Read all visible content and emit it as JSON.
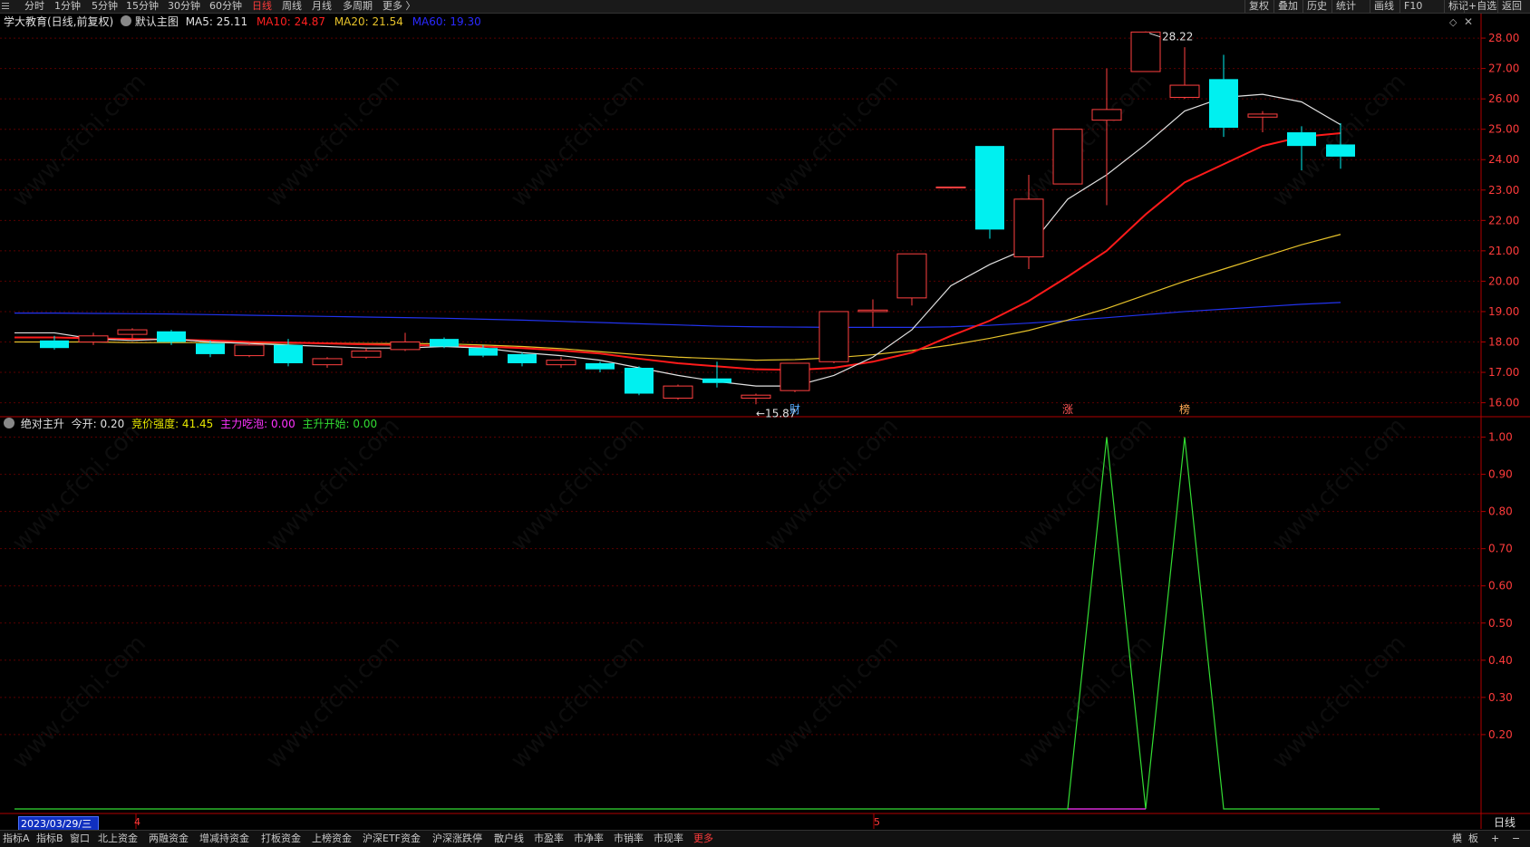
{
  "topbar": {
    "menu_icon": "hamburger-icon",
    "periods": [
      "分时",
      "1分钟",
      "5分钟",
      "15分钟",
      "30分钟",
      "60分钟",
      "日线",
      "周线",
      "月线",
      "多周期",
      "更多 〉"
    ],
    "active_period": "日线",
    "right_buttons": [
      "复权",
      "叠加",
      "历史",
      "统计",
      "画线",
      "F10",
      "+自选",
      "返回"
    ],
    "right_extras": [
      "标记"
    ]
  },
  "main_legend": {
    "title": "学大教育(日线,前复权)",
    "preset": "默认主图",
    "ma5_label": "MA5: 25.11",
    "ma10_label": "MA10: 24.87",
    "ma20_label": "MA20: 21.54",
    "ma60_label": "MA60: 19.30",
    "colors": {
      "ma5": "#e0e0e0",
      "ma10": "#ff2020",
      "ma20": "#e6c22a",
      "ma60": "#2a2aff"
    },
    "corner_icons": [
      "diamond-icon",
      "close-icon"
    ]
  },
  "price_axis": {
    "ticks": [
      "28.00",
      "27.00",
      "26.00",
      "25.00",
      "24.00",
      "23.00",
      "22.00",
      "21.00",
      "20.00",
      "19.00",
      "18.00",
      "17.00",
      "16.00"
    ],
    "high_label": "28.22",
    "low_label": "←15.87"
  },
  "markers": {
    "fin": "财",
    "zhang": "涨",
    "bang": "榜"
  },
  "indicator_legend": {
    "name": "绝对主升",
    "today_open": "今开: 0.20",
    "auction_strength": "竞价强度: 41.45",
    "main_bubble": "主力吃泡: 0.00",
    "main_rise": "主升开始: 0.00",
    "colors": {
      "today_open": "#e0e0e0",
      "auction_strength": "#e6e600",
      "main_bubble": "#ff33ff",
      "main_rise": "#33dd33"
    }
  },
  "indicator_axis": {
    "ticks": [
      "1.00",
      "0.90",
      "0.80",
      "0.70",
      "0.60",
      "0.50",
      "0.40",
      "0.30",
      "0.20"
    ]
  },
  "date_axis": {
    "cursor_date": "2023/03/29/三",
    "month_labels": [
      "4",
      "5"
    ],
    "period_label": "日线"
  },
  "bottombar": {
    "tabs": [
      "指标A",
      "指标B",
      "窗口",
      "北上资金",
      "两融资金",
      "增减持资金",
      "打板资金",
      "上榜资金",
      "沪深ETF资金",
      "沪深涨跌停",
      "散户线",
      "市盈率",
      "市净率",
      "市销率",
      "市现率",
      "更多"
    ],
    "highlight": "更多",
    "right_buttons": [
      "模",
      "板",
      "+",
      "−"
    ]
  },
  "watermark": "www.cfchi.com",
  "chart_data": {
    "type": "candlestick",
    "price_ylim": [
      15.6,
      28.3
    ],
    "candles": [
      {
        "o": 18.05,
        "h": 18.2,
        "l": 17.75,
        "c": 17.8
      },
      {
        "o": 18.0,
        "h": 18.3,
        "l": 17.9,
        "c": 18.2
      },
      {
        "o": 18.25,
        "h": 18.45,
        "l": 18.1,
        "c": 18.4
      },
      {
        "o": 18.35,
        "h": 18.4,
        "l": 17.9,
        "c": 18.0
      },
      {
        "o": 17.95,
        "h": 18.05,
        "l": 17.5,
        "c": 17.6
      },
      {
        "o": 17.55,
        "h": 17.95,
        "l": 17.5,
        "c": 17.9
      },
      {
        "o": 17.9,
        "h": 18.1,
        "l": 17.2,
        "c": 17.3
      },
      {
        "o": 17.25,
        "h": 17.5,
        "l": 17.15,
        "c": 17.45
      },
      {
        "o": 17.5,
        "h": 17.8,
        "l": 17.45,
        "c": 17.7
      },
      {
        "o": 17.75,
        "h": 18.3,
        "l": 17.7,
        "c": 18.0
      },
      {
        "o": 18.1,
        "h": 18.15,
        "l": 17.8,
        "c": 17.85
      },
      {
        "o": 17.8,
        "h": 17.9,
        "l": 17.5,
        "c": 17.55
      },
      {
        "o": 17.6,
        "h": 17.65,
        "l": 17.2,
        "c": 17.3
      },
      {
        "o": 17.25,
        "h": 17.5,
        "l": 17.15,
        "c": 17.4
      },
      {
        "o": 17.3,
        "h": 17.35,
        "l": 17.0,
        "c": 17.1
      },
      {
        "o": 17.15,
        "h": 17.2,
        "l": 16.25,
        "c": 16.3
      },
      {
        "o": 16.15,
        "h": 16.6,
        "l": 16.1,
        "c": 16.55
      },
      {
        "o": 16.8,
        "h": 17.35,
        "l": 16.5,
        "c": 16.65
      },
      {
        "o": 16.15,
        "h": 16.3,
        "l": 15.95,
        "c": 16.25
      },
      {
        "o": 16.4,
        "h": 17.3,
        "l": 16.35,
        "c": 17.3
      },
      {
        "o": 17.35,
        "h": 19.0,
        "l": 17.3,
        "c": 19.0
      },
      {
        "o": 19.0,
        "h": 19.4,
        "l": 18.5,
        "c": 19.05
      },
      {
        "o": 19.45,
        "h": 20.9,
        "l": 19.2,
        "c": 20.9
      },
      {
        "o": 23.1,
        "h": 23.1,
        "l": 23.05,
        "c": 23.1
      },
      {
        "o": 24.45,
        "h": 24.45,
        "l": 21.4,
        "c": 21.7
      },
      {
        "o": 20.8,
        "h": 23.5,
        "l": 20.4,
        "c": 22.7
      },
      {
        "o": 23.2,
        "h": 23.2,
        "l": 23.2,
        "c": 25.0
      },
      {
        "o": 25.3,
        "h": 27.0,
        "l": 22.5,
        "c": 25.65
      },
      {
        "o": 26.9,
        "h": 28.22,
        "l": 26.9,
        "c": 28.2
      },
      {
        "o": 26.05,
        "h": 27.7,
        "l": 26.0,
        "c": 26.45
      },
      {
        "o": 26.65,
        "h": 27.45,
        "l": 24.75,
        "c": 25.05
      },
      {
        "o": 25.4,
        "h": 25.6,
        "l": 24.9,
        "c": 25.5
      },
      {
        "o": 24.9,
        "h": 25.1,
        "l": 23.65,
        "c": 24.45
      },
      {
        "o": 24.5,
        "h": 25.2,
        "l": 23.7,
        "c": 24.1
      }
    ],
    "ma5": [
      18.3,
      18.1,
      18.05,
      18.1,
      18.0,
      17.95,
      17.9,
      17.85,
      17.8,
      17.8,
      17.85,
      17.8,
      17.65,
      17.55,
      17.4,
      17.15,
      16.9,
      16.7,
      16.55,
      16.55,
      16.9,
      17.5,
      18.4,
      19.85,
      20.55,
      21.1,
      22.7,
      23.5,
      24.5,
      25.6,
      26.05,
      26.15,
      25.9,
      25.15
    ],
    "ma10": [
      18.15,
      18.12,
      18.1,
      18.08,
      18.05,
      18.0,
      17.98,
      17.95,
      17.92,
      17.9,
      17.88,
      17.85,
      17.8,
      17.72,
      17.62,
      17.45,
      17.3,
      17.2,
      17.1,
      17.08,
      17.15,
      17.35,
      17.65,
      18.2,
      18.7,
      19.35,
      20.15,
      21.0,
      22.2,
      23.25,
      23.85,
      24.45,
      24.75,
      24.87
    ],
    "ma20": [
      18.0,
      18.0,
      17.98,
      17.98,
      17.98,
      17.97,
      17.96,
      17.96,
      17.95,
      17.95,
      17.94,
      17.9,
      17.85,
      17.78,
      17.68,
      17.58,
      17.5,
      17.45,
      17.4,
      17.42,
      17.48,
      17.58,
      17.72,
      17.9,
      18.12,
      18.38,
      18.72,
      19.1,
      19.55,
      20.0,
      20.4,
      20.8,
      21.2,
      21.54
    ],
    "ma60": [
      18.95,
      18.94,
      18.93,
      18.92,
      18.9,
      18.88,
      18.86,
      18.84,
      18.82,
      18.8,
      18.78,
      18.75,
      18.72,
      18.68,
      18.64,
      18.6,
      18.56,
      18.52,
      18.5,
      18.49,
      18.48,
      18.48,
      18.48,
      18.5,
      18.55,
      18.62,
      18.7,
      18.8,
      18.9,
      19.0,
      19.08,
      19.16,
      19.24,
      19.3
    ],
    "indicator_ylim": [
      0.0,
      1.05
    ],
    "indicator_series": {
      "name": "主升开始",
      "points": [
        [
          0,
          0
        ],
        [
          26,
          0
        ],
        [
          27,
          1
        ],
        [
          28,
          0
        ],
        [
          29,
          1
        ],
        [
          30,
          0
        ],
        [
          34,
          0
        ]
      ]
    }
  }
}
